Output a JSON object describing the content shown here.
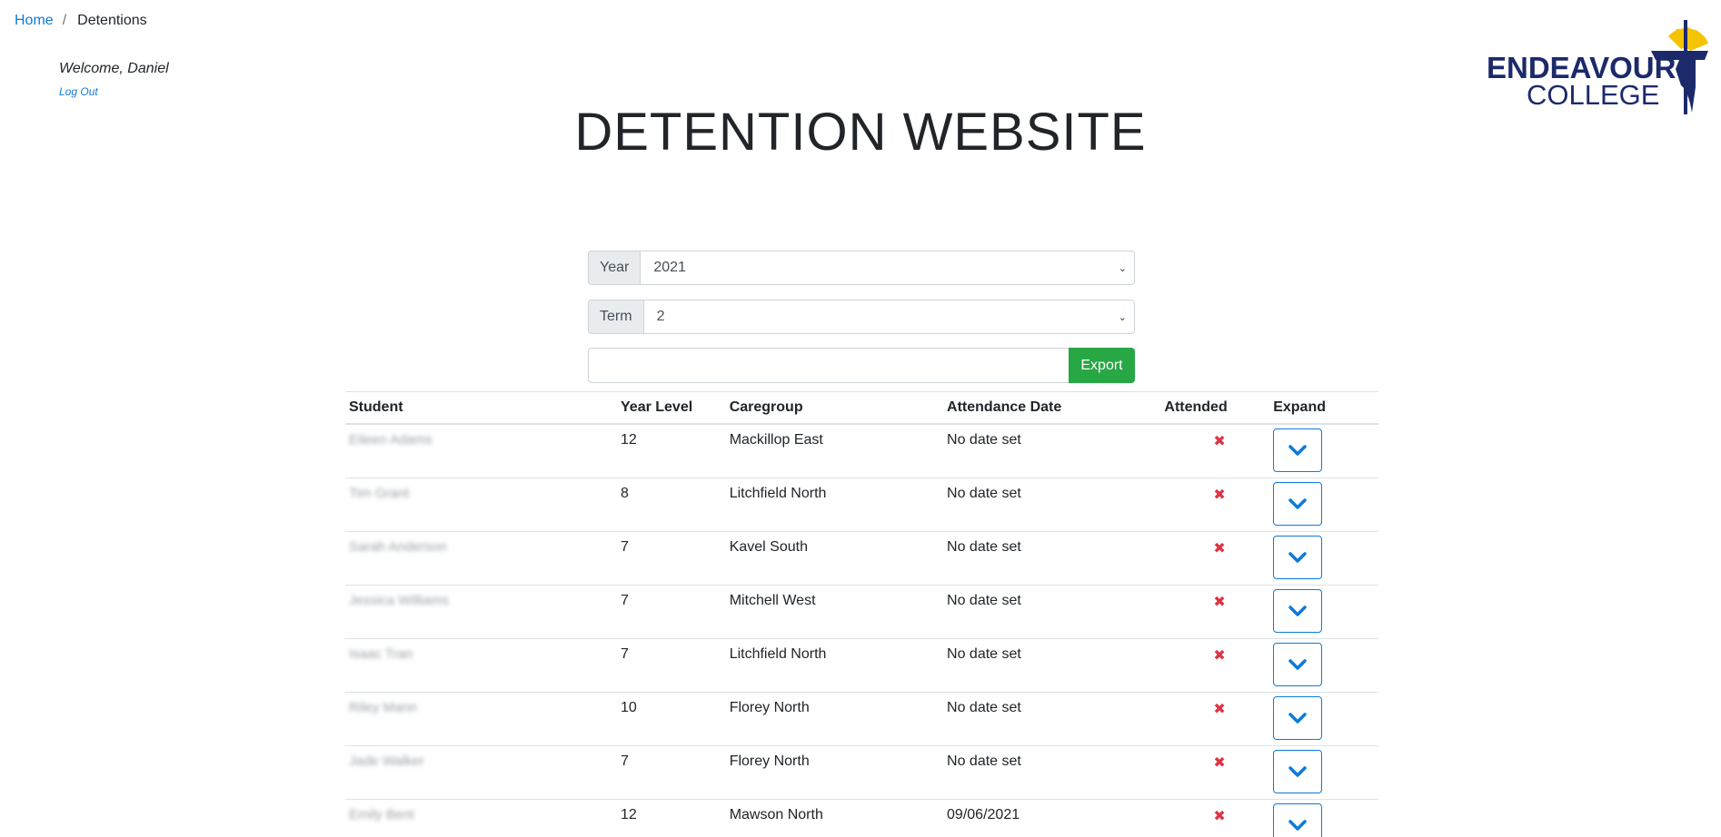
{
  "breadcrumb": {
    "home": "Home",
    "separator": "/",
    "current": "Detentions"
  },
  "user": {
    "welcome": "Welcome, Daniel",
    "logout": "Log Out"
  },
  "logo": {
    "line1": "ENDEAVOUR",
    "line2": "COLLEGE"
  },
  "title": "DETENTION WEBSITE",
  "filters": {
    "year": {
      "label": "Year",
      "value": "2021"
    },
    "term": {
      "label": "Term",
      "value": "2"
    }
  },
  "export": {
    "button": "Export",
    "value": ""
  },
  "table": {
    "headers": [
      "Student",
      "Year Level",
      "Caregroup",
      "Attendance Date",
      "Attended",
      "Expand"
    ],
    "rows": [
      {
        "student": "Eileen Adams",
        "year": "12",
        "caregroup": "Mackillop East",
        "date": "No date set",
        "attended": "✖"
      },
      {
        "student": "Tim Grant",
        "year": "8",
        "caregroup": "Litchfield North",
        "date": "No date set",
        "attended": "✖"
      },
      {
        "student": "Sarah Anderson",
        "year": "7",
        "caregroup": "Kavel South",
        "date": "No date set",
        "attended": "✖"
      },
      {
        "student": "Jessica Williams",
        "year": "7",
        "caregroup": "Mitchell West",
        "date": "No date set",
        "attended": "✖"
      },
      {
        "student": "Isaac Tran",
        "year": "7",
        "caregroup": "Litchfield North",
        "date": "No date set",
        "attended": "✖"
      },
      {
        "student": "Riley Mann",
        "year": "10",
        "caregroup": "Florey North",
        "date": "No date set",
        "attended": "✖"
      },
      {
        "student": "Jade Walker",
        "year": "7",
        "caregroup": "Florey North",
        "date": "No date set",
        "attended": "✖"
      },
      {
        "student": "Emily Bent",
        "year": "12",
        "caregroup": "Mawson North",
        "date": "09/06/2021",
        "attended": "✖"
      }
    ]
  },
  "colors": {
    "link": "#0d7ad9",
    "export": "#28a745",
    "cross": "#dc3545",
    "logo_navy": "#1c2a6b",
    "logo_sun": "#f5c400"
  }
}
